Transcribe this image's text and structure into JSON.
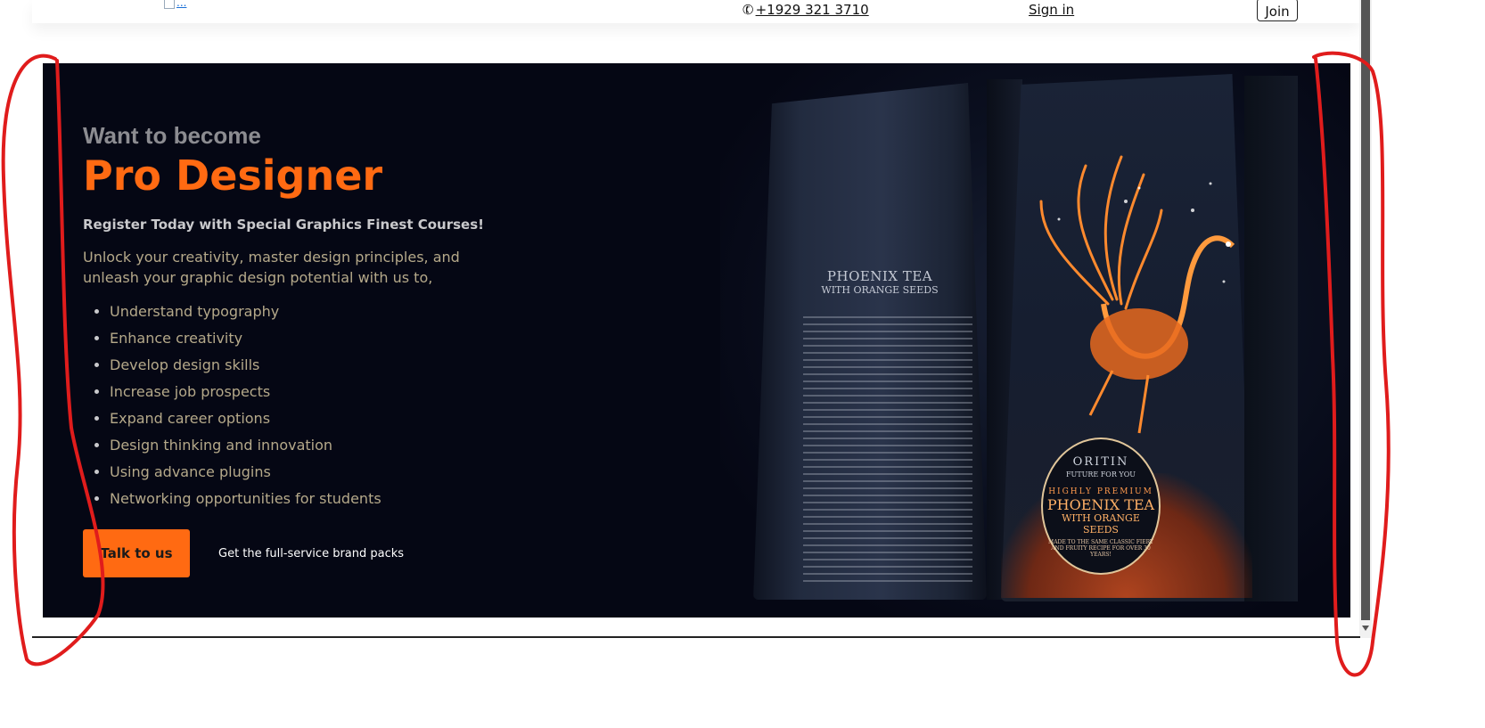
{
  "header": {
    "logo_alt": "...",
    "phone": "+1929 321 3710",
    "signin": "Sign in",
    "join": "Join"
  },
  "hero": {
    "kicker": "Want to become",
    "headline": "Pro Designer",
    "subhead": "Register Today with Special Graphics Finest Courses!",
    "description": "Unlock your creativity, master design principles, and unleash your graphic design potential with us to,",
    "features": [
      "Understand typography",
      "Enhance creativity",
      "Develop design skills",
      "Increase job prospects",
      "Expand career options",
      "Design thinking and innovation",
      "Using advance plugins",
      "Networking opportunities for students"
    ],
    "cta_label": "Talk to us",
    "cta_note": "Get the full-service brand packs"
  },
  "product": {
    "back_title": "PHOENIX TEA",
    "back_subtitle": "WITH ORANGE SEEDS",
    "badge_brand": "ORITIN",
    "badge_tagline": "FUTURE FOR YOU",
    "badge_premium": "HIGHLY PREMIUM",
    "badge_name": "PHOENIX TEA",
    "badge_seeds": "WITH ORANGE SEEDS",
    "badge_foot": "MADE TO THE SAME CLASSIC FIERY AND FRUITY RECIPE FOR OVER 30 YEARS!"
  },
  "colors": {
    "accent": "#ff6a12",
    "hero_bg": "#050714",
    "annotation": "#e01c1c"
  }
}
